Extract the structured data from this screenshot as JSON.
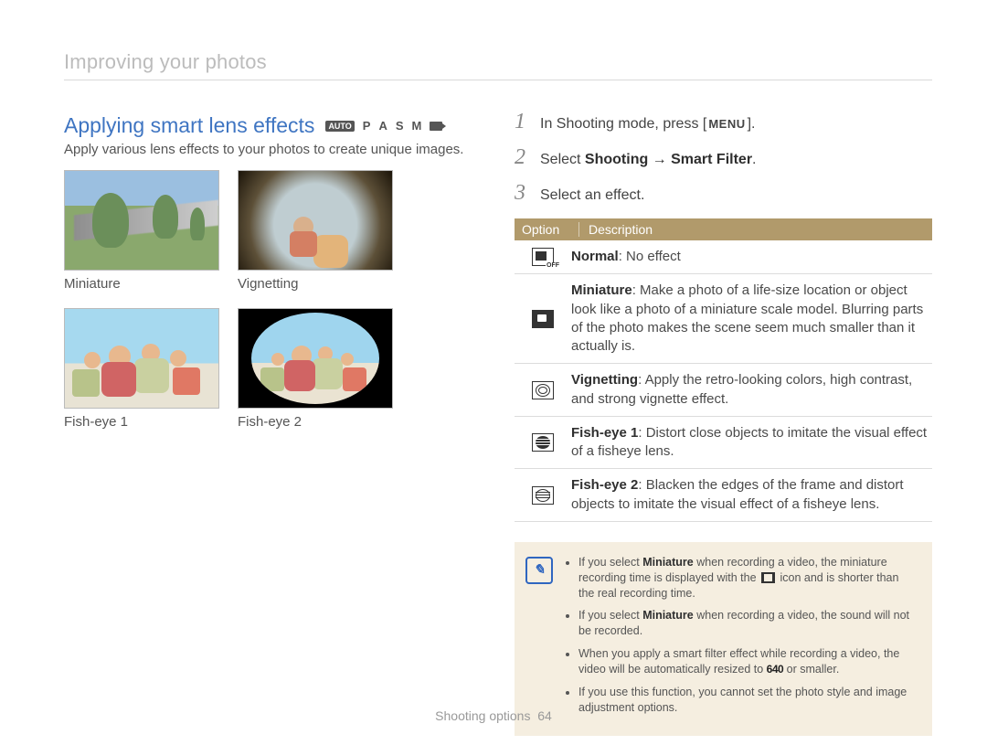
{
  "breadcrumb": "Improving your photos",
  "heading": "Applying smart lens effects",
  "mode_icons": {
    "auto": "AUTO",
    "p": "P",
    "a": "A",
    "s": "S",
    "m": "M"
  },
  "intro": "Apply various lens effects to your photos to create unique images.",
  "thumbs": {
    "miniature": "Miniature",
    "vignetting": "Vignetting",
    "fisheye1": "Fish-eye 1",
    "fisheye2": "Fish-eye 2"
  },
  "steps": {
    "s1": {
      "no": "1",
      "pre": "In Shooting mode, press [",
      "menu_glyph": "MENU",
      "post": "]."
    },
    "s2": {
      "no": "2",
      "pre": "Select ",
      "bold": "Shooting → Smart Filter",
      "post": "."
    },
    "s3": {
      "no": "3",
      "text": "Select an effect."
    }
  },
  "table": {
    "th_option": "Option",
    "th_desc": "Description",
    "rows": {
      "normal": {
        "label": "Normal",
        "sep": ": ",
        "text": "No effect"
      },
      "miniature": {
        "label": "Miniature",
        "sep": ": ",
        "text": "Make a photo of a life-size location or object look like a photo of a miniature scale model. Blurring parts of the photo makes the scene seem much smaller than it actually is."
      },
      "vignetting": {
        "label": "Vignetting",
        "sep": ": ",
        "text": "Apply the retro-looking colors, high contrast, and strong vignette effect."
      },
      "fisheye1": {
        "label": "Fish-eye 1",
        "sep": ": ",
        "text": "Distort close objects to imitate the visual effect of a fisheye lens."
      },
      "fisheye2": {
        "label": "Fish-eye 2",
        "sep": ": ",
        "text": "Blacken the edges of the frame and distort objects to imitate the visual effect of a fisheye lens."
      }
    }
  },
  "notes": {
    "n1a": "If you select ",
    "n1b": "Miniature",
    "n1c": " when recording a video, the miniature recording time is displayed with the ",
    "n1d": " icon and is shorter than the real recording time.",
    "n2a": "If you select ",
    "n2b": "Miniature",
    "n2c": " when recording a video, the sound will not be recorded.",
    "n3a": "When you apply a smart filter effect while recording a video, the video will be automatically resized to ",
    "n3b": "640",
    "n3c": " or smaller.",
    "n4": "If you use this function, you cannot set the photo style and image adjustment options."
  },
  "footer": {
    "section": "Shooting options",
    "page": "64"
  }
}
